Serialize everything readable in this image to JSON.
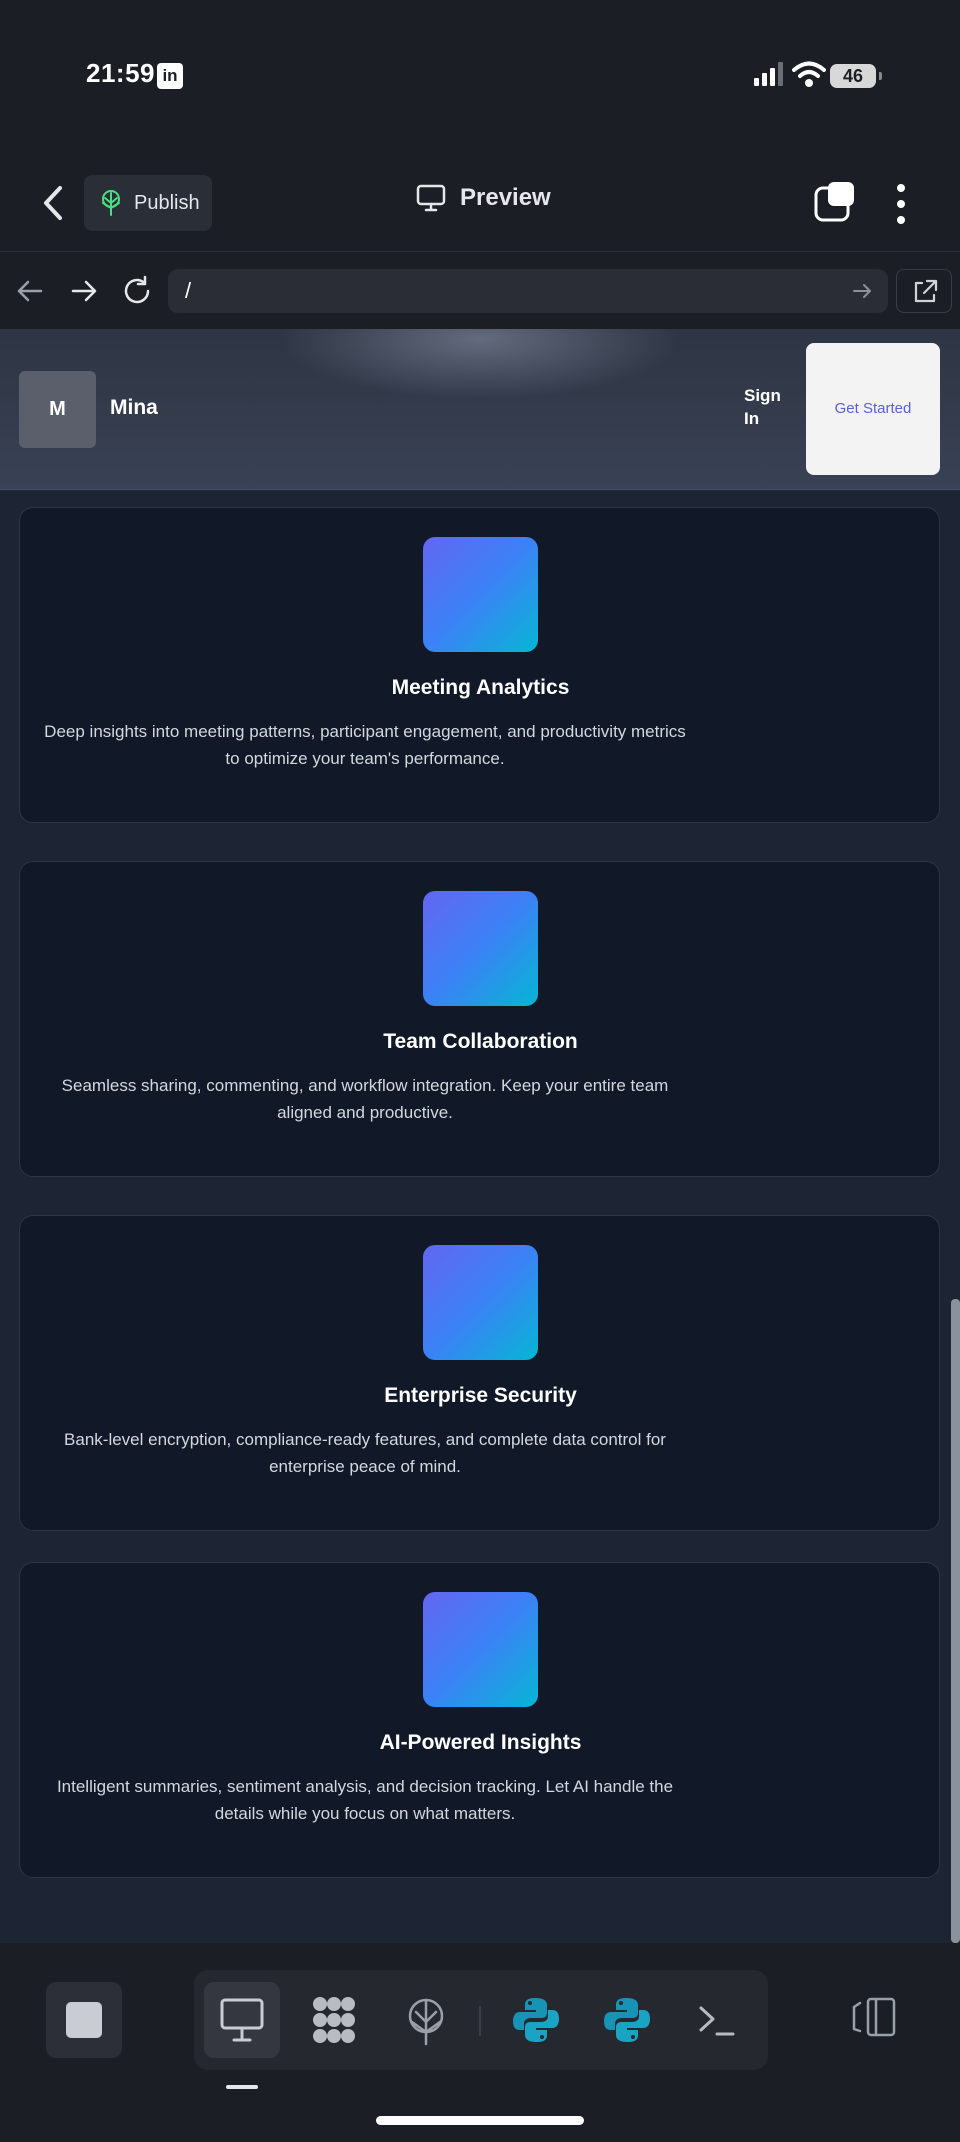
{
  "status_bar": {
    "time": "21:59",
    "battery": "46",
    "notification_app": "in"
  },
  "app_bar": {
    "publish_label": "Publish",
    "preview_label": "Preview"
  },
  "url_bar": {
    "value": "/"
  },
  "site": {
    "logo_letter": "M",
    "brand": "Mina",
    "signin_label": "Sign In",
    "cta_label": "Get Started"
  },
  "features": [
    {
      "title": "Meeting Analytics",
      "description": "Deep insights into meeting patterns, participant engagement, and productivity metrics to optimize your team's performance."
    },
    {
      "title": "Team Collaboration",
      "description": "Seamless sharing, commenting, and workflow integration. Keep your entire team aligned and productive."
    },
    {
      "title": "Enterprise Security",
      "description": "Bank-level encryption, compliance-ready features, and complete data control for enterprise peace of mind."
    },
    {
      "title": "AI-Powered Insights",
      "description": "Intelligent summaries, sentiment analysis, and decision tracking. Let AI handle the details while you focus on what matters."
    }
  ],
  "dock": {
    "items": [
      "monitor-icon",
      "network-icon",
      "publish-tree-icon",
      "python-icon",
      "python-icon",
      "terminal-icon"
    ]
  },
  "colors": {
    "accent": "#5b5fd6",
    "card_bg": "#111827",
    "icon_gradient_start": "#6366f1",
    "icon_gradient_end": "#06b6d4"
  }
}
